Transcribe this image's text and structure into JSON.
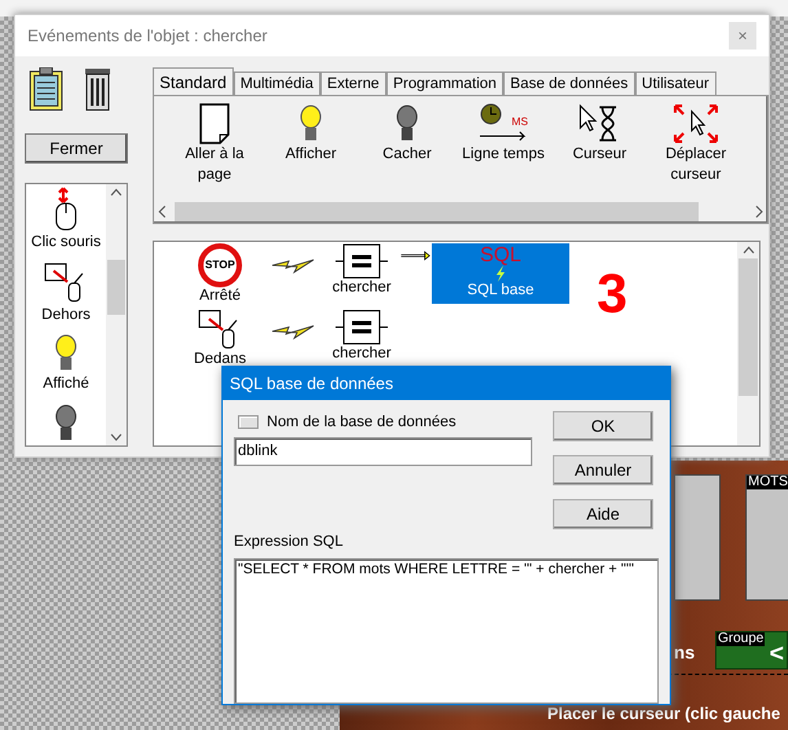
{
  "window": {
    "title": "Evénements de l'objet : chercher",
    "close": "×"
  },
  "close_button": "Fermer",
  "event_list": [
    {
      "kind": "mouse-click",
      "label": "Clic souris"
    },
    {
      "kind": "mouse-out",
      "label": "Dehors"
    },
    {
      "kind": "bulb-on",
      "label": "Affiché"
    },
    {
      "kind": "bulb-off"
    }
  ],
  "tabs": [
    {
      "label": "Standard",
      "selected": true
    },
    {
      "label": "Multimédia",
      "selected": false
    },
    {
      "label": "Externe",
      "selected": false
    },
    {
      "label": "Programmation",
      "selected": false
    },
    {
      "label": "Base de données",
      "selected": false
    },
    {
      "label": "Utilisateur",
      "selected": false
    }
  ],
  "actions": [
    {
      "kind": "page",
      "label": "Aller à la page"
    },
    {
      "kind": "bulb-on",
      "label": "Afficher"
    },
    {
      "kind": "bulb-off",
      "label": "Cacher"
    },
    {
      "kind": "timeline",
      "label": "Ligne temps",
      "badge": "MS"
    },
    {
      "kind": "cursor",
      "label": "Curseur"
    },
    {
      "kind": "move-cursor",
      "label": "Déplacer curseur"
    }
  ],
  "canvas_rows": [
    [
      {
        "kind": "stop",
        "label": "Arrêté",
        "badge": "STOP",
        "selected": false
      },
      {
        "kind": "lightning",
        "selected": false
      },
      {
        "kind": "object",
        "label": "chercher",
        "selected": false
      },
      {
        "kind": "arrow",
        "selected": false
      },
      {
        "kind": "sql",
        "label": "SQL base",
        "badge": "SQL",
        "selected": true
      }
    ],
    [
      {
        "kind": "mouse-in",
        "label": "Dedans",
        "selected": false
      },
      {
        "kind": "lightning",
        "selected": false
      },
      {
        "kind": "object",
        "label": "chercher",
        "selected": false
      }
    ]
  ],
  "annotation": "3",
  "dialog": {
    "title": "SQL base de données",
    "db_checkbox": {
      "label": "Nom de la base de données",
      "checked": false
    },
    "db_name": "dblink",
    "buttons": [
      "OK",
      "Annuler",
      "Aide"
    ],
    "expression_label": "Expression SQL",
    "expression": "\"SELECT * FROM mots WHERE LETTRE = '\" + chercher + \"'\""
  },
  "background": {
    "panel_label": "MOTS",
    "group_label": "Groupe",
    "group_button": "<",
    "caption_fragment": "ns",
    "hint": "Placer le curseur (clic gauche"
  }
}
